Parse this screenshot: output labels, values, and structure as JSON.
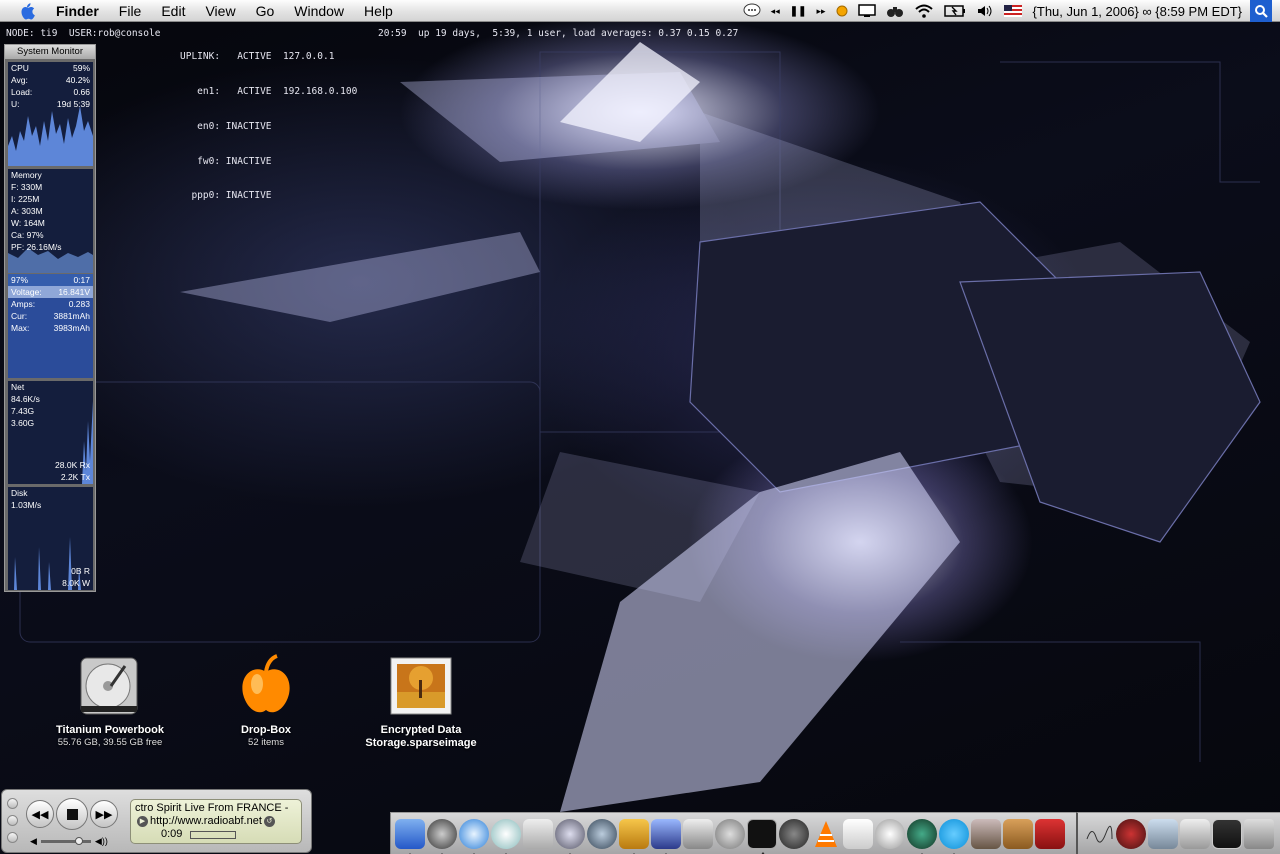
{
  "menubar": {
    "app_name": "Finder",
    "menus": [
      "File",
      "Edit",
      "View",
      "Go",
      "Window",
      "Help"
    ],
    "clock": "{Thu, Jun 1, 2006} ∞ {8:59 PM EDT}"
  },
  "geektool": {
    "node_line": "NODE: ti9  USER:rob@console",
    "net_lines": [
      "UPLINK:   ACTIVE  127.0.0.1",
      "   en1:   ACTIVE  192.168.0.100",
      "   en0: INACTIVE",
      "   fw0: INACTIVE",
      "  ppp0: INACTIVE"
    ],
    "uptime": "20:59  up 19 days,  5:39, 1 user, load averages: 0.37 0.15 0.27"
  },
  "system_monitor": {
    "title": "System Monitor",
    "cpu": [
      [
        "CPU",
        "59%"
      ],
      [
        "Avg:",
        "40.2%"
      ],
      [
        "Load:",
        "0.66"
      ],
      [
        "U:",
        "19d 5:39"
      ]
    ],
    "memory_title": "Memory",
    "memory": [
      "F: 330M",
      "I: 225M",
      "A: 303M",
      "W: 164M",
      "Ca: 97%",
      "PF: 26.16M/s"
    ],
    "battery": [
      [
        "97%",
        "0:17"
      ],
      [
        "Voltage:",
        "16.841V"
      ],
      [
        "Amps:",
        "0.283"
      ],
      [
        "Cur:",
        "3881mAh"
      ],
      [
        "Max:",
        "3983mAh"
      ]
    ],
    "net_title": "Net",
    "net": [
      "84.6K/s",
      "7.43G",
      "3.60G"
    ],
    "net_rx": "28.0K Rx",
    "net_tx": "2.2K Tx",
    "disk_title": "Disk",
    "disk": "1.03M/s",
    "disk_r": "0B R",
    "disk_w": "8.0K W"
  },
  "desktop_icons": [
    {
      "name": "Titanium Powerbook",
      "sub": "55.76 GB, 39.55 GB free"
    },
    {
      "name": "Drop-Box",
      "sub": "52 items"
    },
    {
      "name_line1": "Encrypted Data",
      "name_line2": "Storage.sparseimage"
    }
  ],
  "itunes": {
    "title": "ctro Spirit Live From FRANCE -",
    "url": "http://www.radioabf.net",
    "time": "0:09",
    "volume_fraction": 0.75
  },
  "colors": {
    "accent": "#1e5fcf",
    "monitor_panel": "#141e3d",
    "battery_panel": "#2b4c9a"
  }
}
